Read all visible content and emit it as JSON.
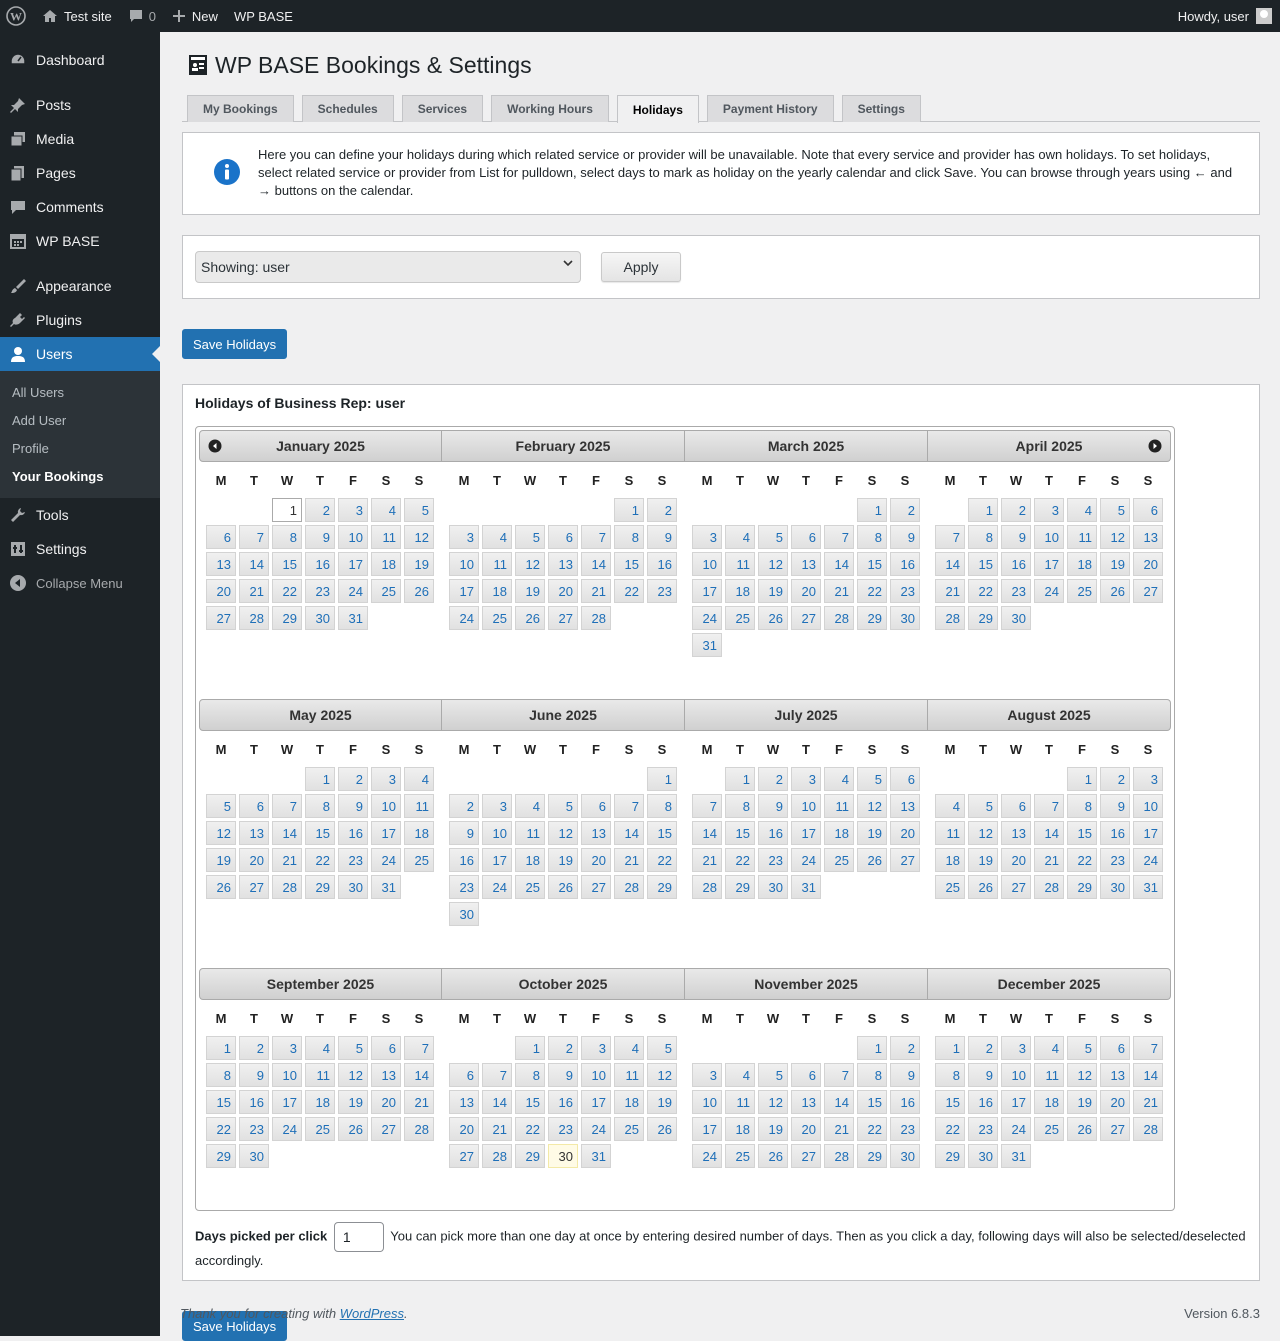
{
  "admin_bar": {
    "site_name": "Test site",
    "comments_count": "0",
    "new_label": "New",
    "plugin_label": "WP BASE",
    "howdy": "Howdy, user"
  },
  "menu": {
    "items": [
      {
        "label": "Dashboard",
        "icon": "dashboard-icon"
      },
      {
        "label": "Posts",
        "icon": "pin-icon"
      },
      {
        "label": "Media",
        "icon": "media-icon"
      },
      {
        "label": "Pages",
        "icon": "pages-icon"
      },
      {
        "label": "Comments",
        "icon": "comments-icon"
      },
      {
        "label": "WP BASE",
        "icon": "calendar-icon"
      },
      {
        "label": "Appearance",
        "icon": "brush-icon"
      },
      {
        "label": "Plugins",
        "icon": "plug-icon"
      },
      {
        "label": "Users",
        "icon": "user-icon"
      },
      {
        "label": "Tools",
        "icon": "wrench-icon"
      },
      {
        "label": "Settings",
        "icon": "settings-icon"
      }
    ],
    "users_submenu": [
      "All Users",
      "Add User",
      "Profile",
      "Your Bookings"
    ],
    "collapse": "Collapse Menu"
  },
  "page": {
    "title": "WP BASE Bookings & Settings",
    "tabs": [
      "My Bookings",
      "Schedules",
      "Services",
      "Working Hours",
      "Holidays",
      "Payment History",
      "Settings"
    ],
    "active_tab": "Holidays",
    "notice": "Here you can define your holidays during which related service or provider will be unavailable. Note that every service and provider has own holidays. To set holidays, select related service or provider from List for pulldown, select days to mark as holiday on the yearly calendar and click Save. You can browse through years using ← and → buttons on the calendar.",
    "select_value": "Showing: user",
    "apply_label": "Apply",
    "save_label": "Save Holidays",
    "holidays_title": "Holidays of Business Rep: user",
    "weekdays": [
      "M",
      "T",
      "W",
      "T",
      "F",
      "S",
      "S"
    ],
    "months": [
      "January 2025",
      "February 2025",
      "March 2025",
      "April 2025",
      "May 2025",
      "June 2025",
      "July 2025",
      "August 2025",
      "September 2025",
      "October 2025",
      "November 2025",
      "December 2025"
    ],
    "days_picked_label": "Days picked per click",
    "days_picked_value": "1",
    "days_picked_help": "You can pick more than one day at once by entering desired number of days. Then as you click a day, following days will also be selected/deselected accordingly."
  },
  "footer": {
    "thanks_prefix": "Thank you for creating with ",
    "thanks_link": "WordPress",
    "thanks_suffix": ".",
    "version": "Version 6.8.3"
  },
  "colors": {
    "admin_dark": "#1d2327",
    "accent": "#2271b1",
    "day_link": "#1e6fb8"
  }
}
